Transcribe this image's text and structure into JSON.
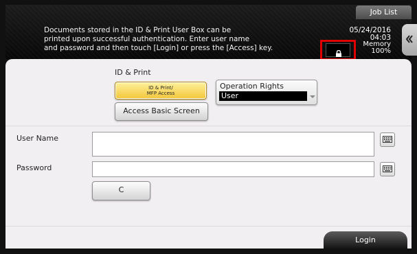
{
  "header": {
    "job_list_label": "Job List",
    "message": "Documents stored in the ID & Print User Box can be\nprinted upon successful authentication. Enter user name\nand password and then touch [Login] or press the [Access] key.",
    "date": "05/24/2016",
    "time": "04:03",
    "memory_label": "Memory",
    "memory_value": "100%",
    "lock_icon": "lock-icon",
    "side_tab_icon": "double-chevron-left-icon"
  },
  "id_print": {
    "section_label": "ID & Print",
    "mode_button_line1": "ID & Print/",
    "mode_button_line2": "MFP Access",
    "basic_screen_button": "Access Basic Screen"
  },
  "operation_rights": {
    "label": "Operation Rights",
    "selected": "User"
  },
  "form": {
    "user_name_label": "User Name",
    "user_name_value": "",
    "password_label": "Password",
    "password_value": "",
    "keyboard_icon": "keyboard-icon",
    "clear_button": "C"
  },
  "footer": {
    "login_button": "Login"
  },
  "colors": {
    "highlight_border": "#e00000",
    "selected_mode_button": "#f7d65a",
    "panel_background": "#f2eff2"
  }
}
